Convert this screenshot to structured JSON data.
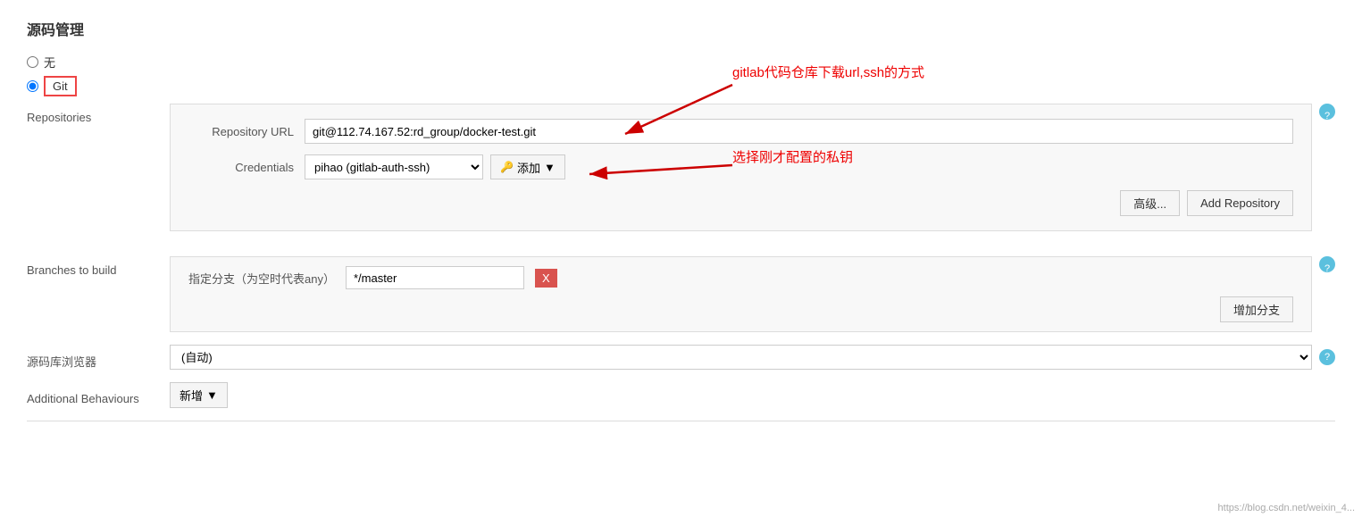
{
  "page": {
    "title": "源码管理",
    "scm_section": {
      "title": "源码管理",
      "options": [
        {
          "label": "无",
          "value": "none",
          "checked": false
        },
        {
          "label": "Git",
          "value": "git",
          "checked": true
        }
      ]
    },
    "repositories": {
      "label": "Repositories",
      "repo_url_label": "Repository URL",
      "repo_url_value": "git@112.74.167.52:rd_group/docker-test.git",
      "credentials_label": "Credentials",
      "credentials_value": "pihao (gitlab-auth-ssh)",
      "add_button_label": "添加",
      "advanced_button": "高级...",
      "add_repository_button": "Add Repository"
    },
    "branches": {
      "label": "Branches to build",
      "branch_label": "指定分支（为空时代表any）",
      "branch_value": "*/master",
      "delete_button": "X",
      "add_branch_button": "增加分支"
    },
    "browser": {
      "label": "源码库浏览器",
      "value": "(自动)",
      "options": [
        "(自动)"
      ]
    },
    "behaviours": {
      "label": "Additional Behaviours",
      "new_button_label": "新增"
    },
    "annotations": {
      "gitlab_url_text": "gitlab代码仓库下载url,ssh的方式",
      "credentials_text": "选择刚才配置的私钥"
    },
    "watermark": "https://blog.csdn.net/weixin_4...",
    "help_icon": "?",
    "chevron_down": "▼"
  }
}
